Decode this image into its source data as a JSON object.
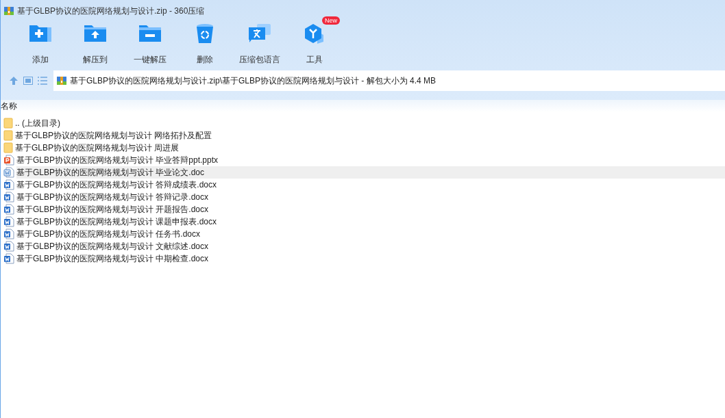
{
  "window": {
    "title": "基于GLBP协议的医院网络规划与设计.zip - 360压缩"
  },
  "toolbar": [
    {
      "kind": "add",
      "label": "添加"
    },
    {
      "kind": "extract",
      "label": "解压到"
    },
    {
      "kind": "oneclick",
      "label": "一键解压"
    },
    {
      "kind": "delete",
      "label": "删除"
    },
    {
      "kind": "language",
      "label": "压缩包语言"
    },
    {
      "kind": "tools",
      "label": "工具",
      "badge": "New"
    }
  ],
  "address_bar": {
    "path": "基于GLBP协议的医院网络规划与设计.zip\\基于GLBP协议的医院网络规划与设计 - 解包大小为 4.4 MB"
  },
  "table": {
    "columns": [
      "名称"
    ],
    "rows": [
      {
        "kind": "folder",
        "name": ".. (上级目录)",
        "selected": false
      },
      {
        "kind": "folder",
        "name": "基于GLBP协议的医院网络规划与设计 网络拓扑及配置",
        "selected": false
      },
      {
        "kind": "folder",
        "name": "基于GLBP协议的医院网络规划与设计 周进展",
        "selected": false
      },
      {
        "kind": "ppt",
        "name": "基于GLBP协议的医院网络规划与设计 毕业答辩ppt.pptx",
        "selected": false
      },
      {
        "kind": "doc",
        "name": "基于GLBP协议的医院网络规划与设计 毕业论文.doc",
        "selected": true
      },
      {
        "kind": "docx",
        "name": "基于GLBP协议的医院网络规划与设计 答辩成绩表.docx",
        "selected": false
      },
      {
        "kind": "docx",
        "name": "基于GLBP协议的医院网络规划与设计 答辩记录.docx",
        "selected": false
      },
      {
        "kind": "docx",
        "name": "基于GLBP协议的医院网络规划与设计 开题报告.docx",
        "selected": false
      },
      {
        "kind": "docx",
        "name": "基于GLBP协议的医院网络规划与设计 课题申报表.docx",
        "selected": false
      },
      {
        "kind": "docx",
        "name": "基于GLBP协议的医院网络规划与设计 任务书.docx",
        "selected": false
      },
      {
        "kind": "docx",
        "name": "基于GLBP协议的医院网络规划与设计 文献综述.docx",
        "selected": false
      },
      {
        "kind": "docx",
        "name": "基于GLBP协议的医院网络规划与设计 中期检查.docx",
        "selected": false
      }
    ]
  }
}
